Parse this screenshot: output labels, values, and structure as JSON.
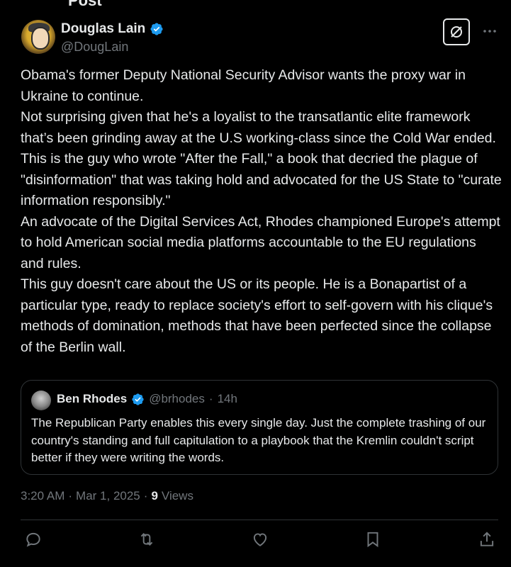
{
  "header": {
    "title": "Post"
  },
  "author": {
    "name": "Douglas Lain",
    "handle": "@DougLain",
    "verified": true
  },
  "tweet": {
    "paragraphs": [
      "Obama's former Deputy National Security Advisor wants the proxy war in Ukraine to continue.",
      "Not surprising given that he's a loyalist to the transatlantic elite framework that’s been grinding away at the U.S working-class since the Cold War ended.",
      "This is the guy who wrote \"After the Fall,\" a book that decried the plague of \"disinformation\" that was taking hold and advocated for the US State to \"curate information responsibly.\"",
      "An advocate of the Digital Services Act, Rhodes championed Europe's attempt to hold American social media platforms accountable to the EU regulations and rules.",
      "This guy doesn't care about the US or its people. He is a Bonapartist of a particular type, ready to replace society's effort to self-govern with his clique's methods of domination, methods that have been perfected since the collapse of the Berlin wall."
    ]
  },
  "quote": {
    "name": "Ben Rhodes",
    "handle": "@brhodes",
    "separator": "·",
    "time": "14h",
    "text": "The Republican Party enables this every single day. Just the complete trashing of our country's standing and full capitulation to a playbook that the Kremlin couldn't script better if they were writing the words."
  },
  "meta": {
    "time": "3:20 AM",
    "sep1": "·",
    "date": "Mar 1, 2025",
    "sep2": "·",
    "views_count": "9",
    "views_label": "Views"
  },
  "icons": {
    "more": "more-horizontal-icon",
    "grok": "grok-icon",
    "reply": "reply-icon",
    "retweet": "retweet-icon",
    "like": "like-icon",
    "bookmark": "bookmark-icon",
    "share": "share-icon"
  },
  "colors": {
    "background": "#000000",
    "text": "#e7e9ea",
    "secondary": "#71767b",
    "verified": "#1d9bf0",
    "border": "#2f3336"
  }
}
